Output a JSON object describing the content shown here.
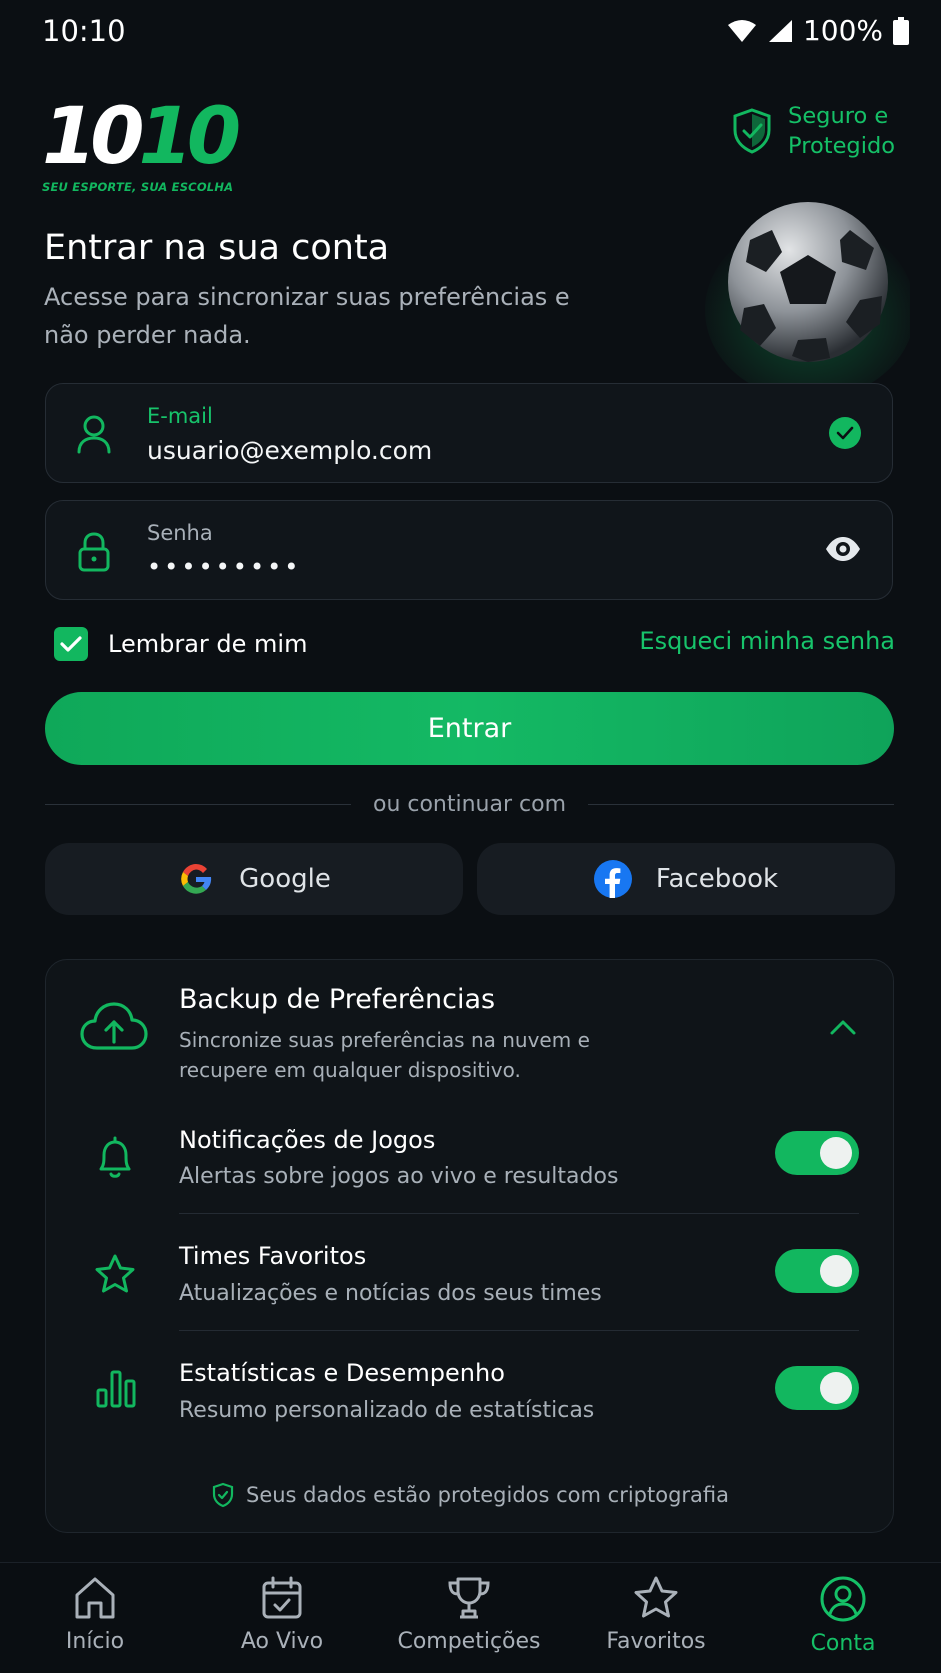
{
  "status_bar": {
    "time": "10:10",
    "battery": "100%"
  },
  "header": {
    "logo_white": "10",
    "logo_green": "10",
    "tagline": "SEU ESPORTE, SUA ESCOLHA",
    "secure_line1": "Seguro e",
    "secure_line2": "Protegido"
  },
  "login": {
    "title": "Entrar na sua conta",
    "subtitle": "Acesse para sincronizar suas preferências e não perder nada.",
    "email_label": "E-mail",
    "email_value": "usuario@exemplo.com",
    "password_label": "Senha",
    "password_value": "•••••••••",
    "remember_label": "Lembrar de mim",
    "forgot_label": "Esqueci minha senha",
    "submit_label": "Entrar",
    "divider_text": "ou continuar com",
    "google_label": "Google",
    "facebook_label": "Facebook"
  },
  "backup": {
    "title": "Backup de Preferências",
    "description": "Sincronize suas preferências na nuvem e recupere em qualquer dispositivo.",
    "items": [
      {
        "title": "Notificações de Jogos",
        "subtitle": "Alertas sobre jogos ao vivo e resultados",
        "enabled": true
      },
      {
        "title": "Times Favoritos",
        "subtitle": "Atualizações e notícias dos seus times",
        "enabled": true
      },
      {
        "title": "Estatísticas e Desempenho",
        "subtitle": "Resumo personalizado de estatísticas",
        "enabled": true
      }
    ],
    "privacy_note": "Seus dados estão protegidos com criptografia"
  },
  "nav": {
    "items": [
      {
        "label": "Início",
        "icon": "home-icon"
      },
      {
        "label": "Ao Vivo",
        "icon": "calendar-icon"
      },
      {
        "label": "Competições",
        "icon": "trophy-icon"
      },
      {
        "label": "Favoritos",
        "icon": "star-icon"
      },
      {
        "label": "Conta",
        "icon": "user-icon",
        "active": true
      }
    ]
  },
  "colors": {
    "accent": "#12b75f",
    "background": "#0b0f13",
    "card": "#0f1418"
  }
}
